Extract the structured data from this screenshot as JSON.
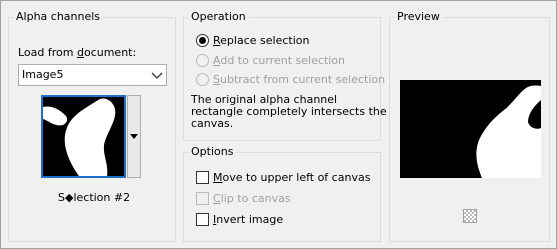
{
  "alpha": {
    "title": "Alpha channels",
    "load_prefix": "Load from ",
    "load_accel": "d",
    "load_suffix": "ocument:",
    "document_value": "Image5",
    "selection_name": "S◆lection #2"
  },
  "operation": {
    "title": "Operation",
    "options": [
      {
        "accel": "R",
        "rest": "eplace selection",
        "selected": true,
        "enabled": true
      },
      {
        "accel": "A",
        "rest": "dd to current selection",
        "selected": false,
        "enabled": false
      },
      {
        "accel": "S",
        "rest": "ubtract from current selection",
        "selected": false,
        "enabled": false
      }
    ],
    "info": [
      "The original alpha channel",
      "rectangle completely intersects the",
      "canvas."
    ]
  },
  "options": {
    "title": "Options",
    "move": {
      "accel": "M",
      "rest": "ove to upper left of canvas",
      "checked": false,
      "enabled": true
    },
    "clip": {
      "accel": "C",
      "rest": "lip to canvas",
      "checked": false,
      "enabled": false
    },
    "invert": {
      "accel": "I",
      "rest": "nvert image",
      "checked": false,
      "enabled": true
    }
  },
  "preview": {
    "title": "Preview",
    "background_icon": "checkerboard-icon"
  },
  "colors": {
    "accent": "#1e6fc7",
    "disabled_text": "#a0a0a0",
    "panel": "#f0f0f0"
  }
}
